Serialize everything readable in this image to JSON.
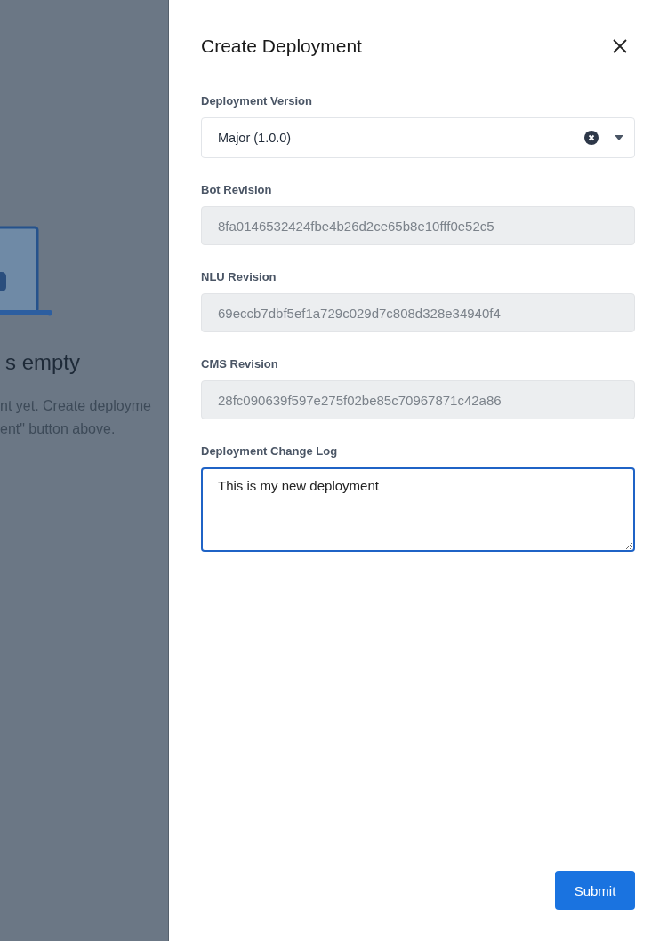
{
  "background": {
    "heading": "s empty",
    "description_lines": [
      "nt yet. Create deployme",
      "ent\" button above."
    ]
  },
  "drawer": {
    "title": "Create Deployment",
    "fields": [
      {
        "kind": "select",
        "label": "Deployment Version",
        "value": "Major (1.0.0)"
      },
      {
        "kind": "readonly",
        "label": "Bot Revision",
        "value": "8fa0146532424fbe4b26d2ce65b8e10fff0e52c5"
      },
      {
        "kind": "readonly",
        "label": "NLU Revision",
        "value": "69eccb7dbf5ef1a729c029d7c808d328e34940f4"
      },
      {
        "kind": "readonly",
        "label": "CMS Revision",
        "value": "28fc090639f597e275f02be85c70967871c42a86"
      },
      {
        "kind": "textarea",
        "label": "Deployment Change Log",
        "value": "This is my new deployment"
      }
    ],
    "submit_button": "Submit"
  }
}
